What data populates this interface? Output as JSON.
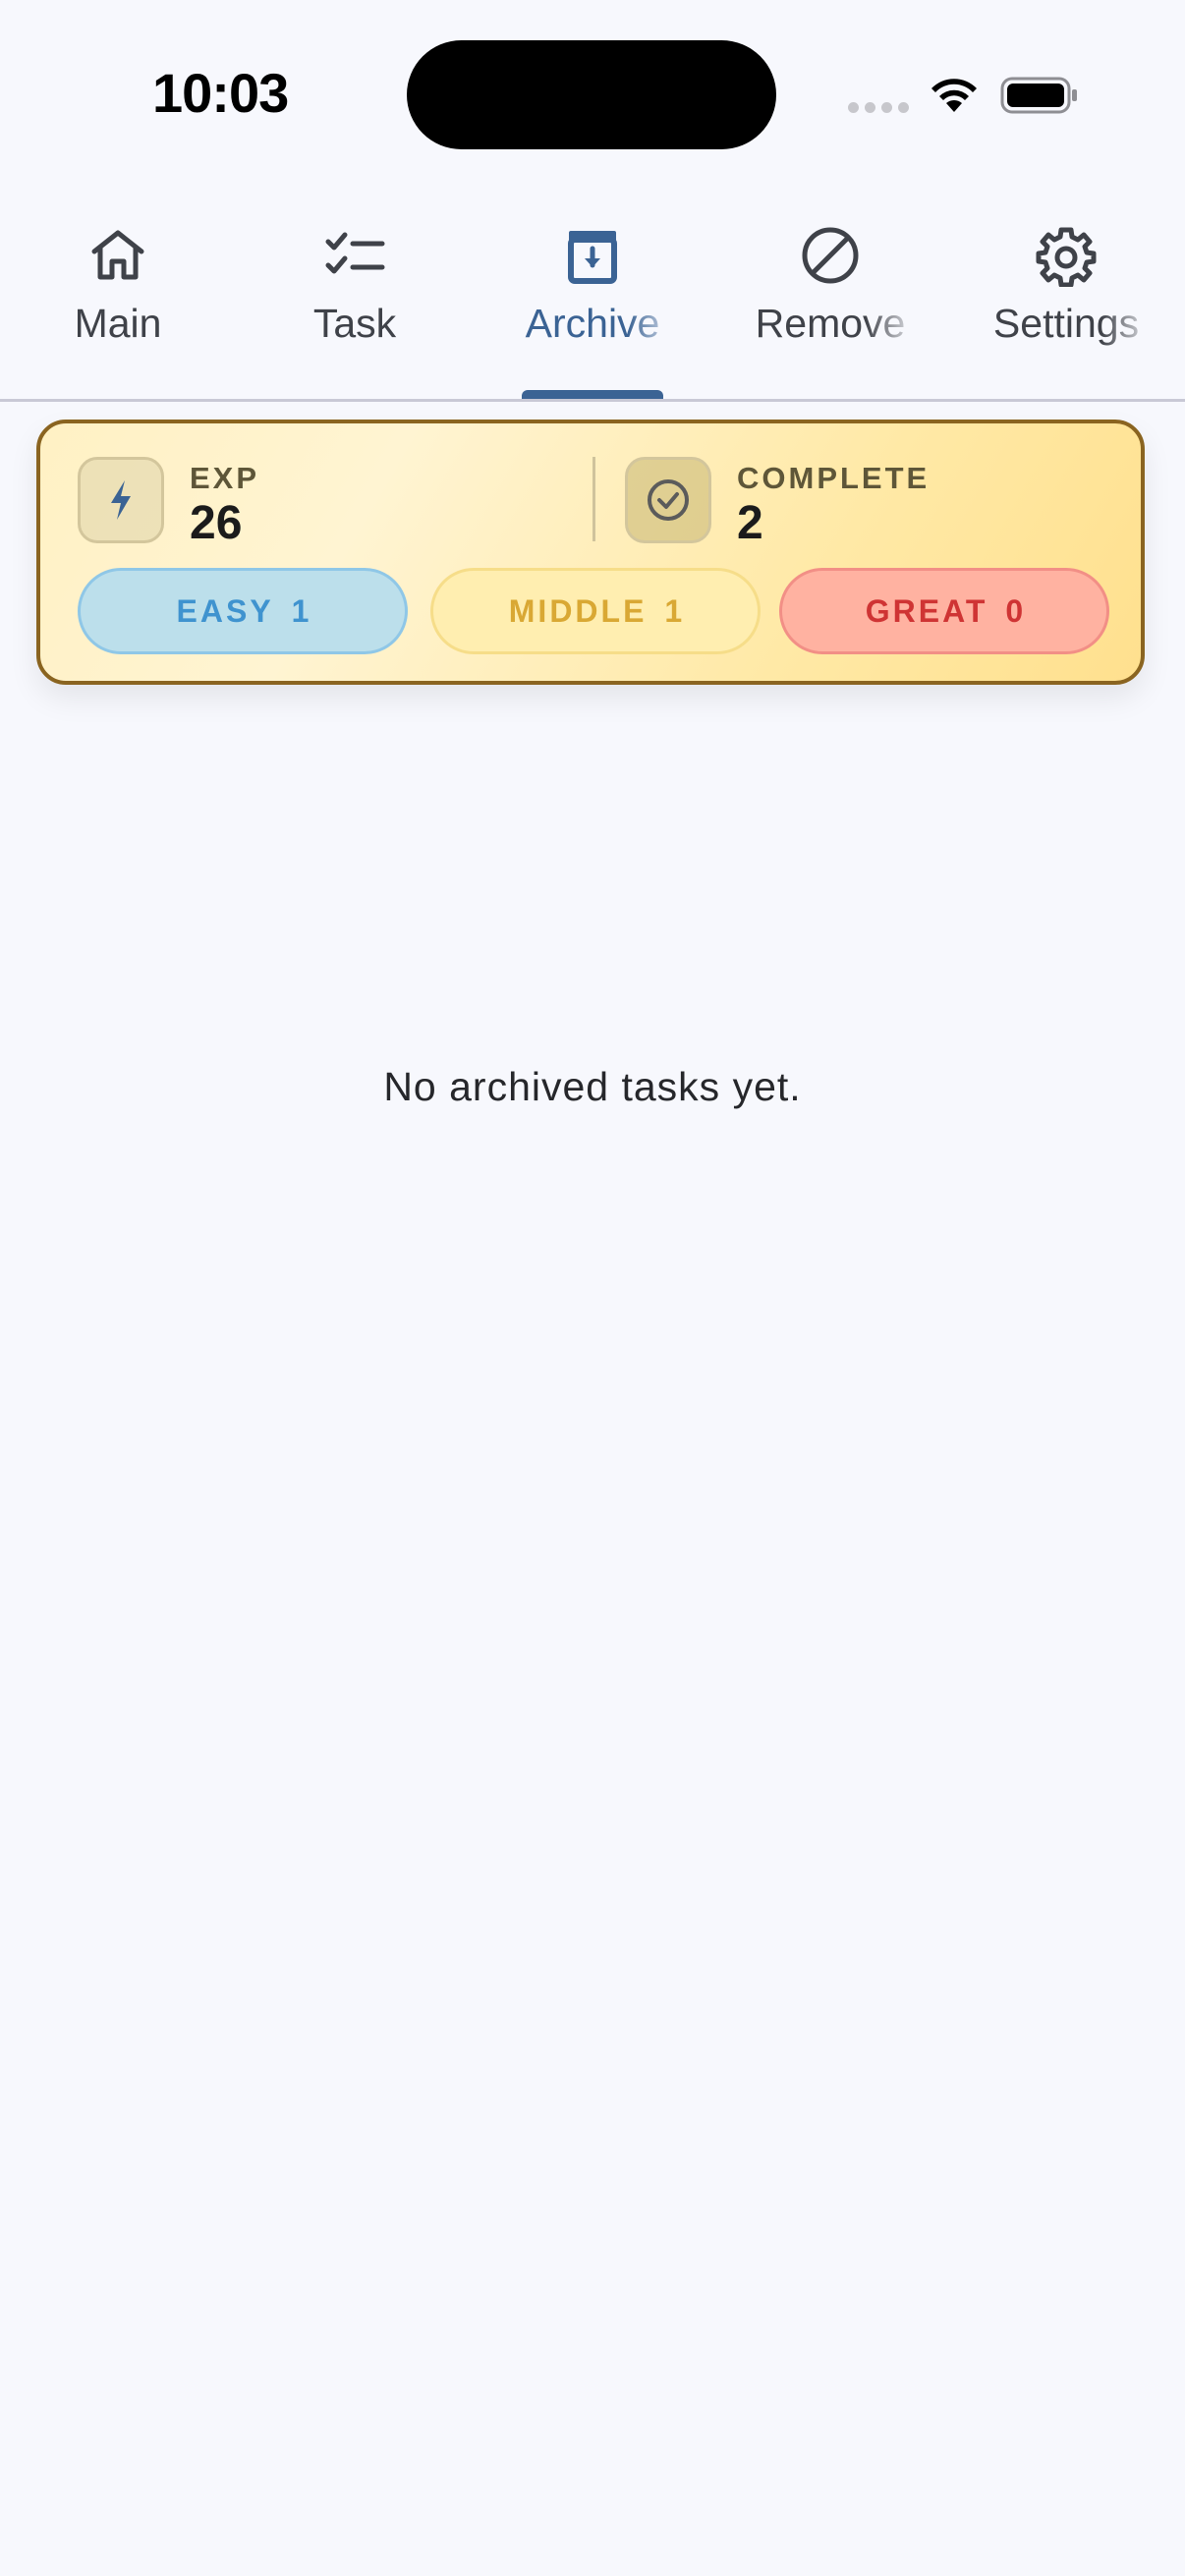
{
  "status_bar": {
    "time": "10:03",
    "icons": [
      "cellular-signal-icon",
      "wifi-icon",
      "battery-icon"
    ]
  },
  "tabs": [
    {
      "label": "Main",
      "icon": "home-icon",
      "active": false
    },
    {
      "label": "Task",
      "icon": "checklist-icon",
      "active": false
    },
    {
      "label": "Archive",
      "icon": "archive-box-icon",
      "active": true
    },
    {
      "label": "Remove",
      "icon": "prohibited-icon",
      "active": false
    },
    {
      "label": "Settings",
      "icon": "gear-icon",
      "active": false
    }
  ],
  "stats": {
    "exp": {
      "label": "EXP",
      "value": "26",
      "icon": "lightning-icon"
    },
    "complete": {
      "label": "COMPLETE",
      "value": "2",
      "icon": "check-circle-icon"
    },
    "difficulty": [
      {
        "label": "EASY",
        "count": "1",
        "color": "#3f93cf"
      },
      {
        "label": "MIDDLE",
        "count": "1",
        "color": "#d9a834"
      },
      {
        "label": "GREAT",
        "count": "0",
        "color": "#cf3434"
      }
    ]
  },
  "archive": {
    "empty_message": "No archived tasks yet."
  },
  "colors": {
    "accent": "#3b6394",
    "background": "#f7f8fd",
    "card_border": "#8a6420"
  }
}
